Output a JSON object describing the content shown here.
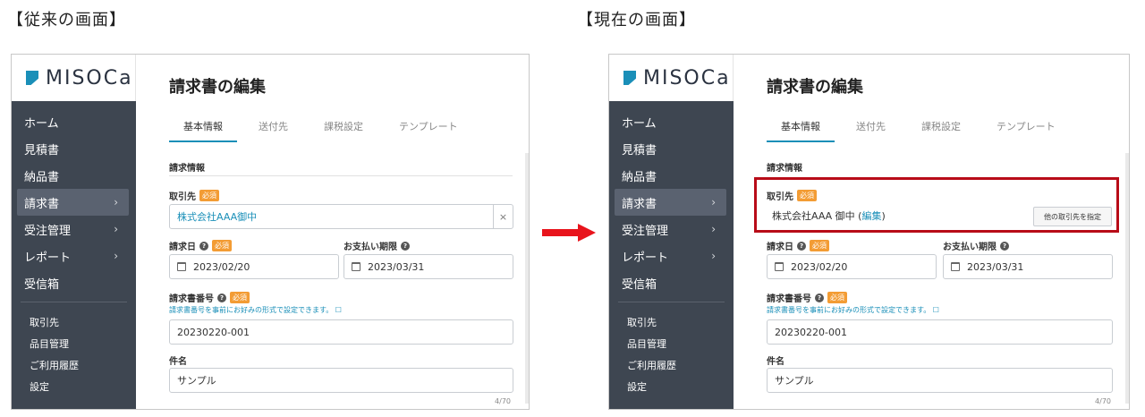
{
  "captions": {
    "left": "【従来の画面】",
    "right": "【現在の画面】"
  },
  "colors": {
    "sidebar": "#3e4651",
    "accent": "#1a8fb8",
    "required": "#f39c34",
    "highlight": "#b80c18",
    "arrow": "#e8141c"
  },
  "logo": {
    "text": "MISOCa"
  },
  "nav": {
    "home": "ホーム",
    "estimate": "見積書",
    "delivery": "納品書",
    "invoice": "請求書",
    "orders": "受注管理",
    "report": "レポート",
    "inbox": "受信箱"
  },
  "subnav": {
    "clients": "取引先",
    "items": "品目管理",
    "history": "ご利用履歴",
    "settings": "設定"
  },
  "page": {
    "title": "請求書の編集"
  },
  "tabs": {
    "basic": "基本情報",
    "destination": "送付先",
    "tax": "課税設定",
    "template": "テンプレート"
  },
  "form": {
    "section": "請求情報",
    "client_label": "取引先",
    "required": "必須",
    "client_value_old": "株式会社AAA御中",
    "clear": "×",
    "client_value_new": "株式会社AAA 御中 (",
    "edit_link": "編集",
    "client_close": ")",
    "other_client_button": "他の取引先を指定",
    "invoice_date_label": "請求日",
    "due_date_label": "お支払い期限",
    "invoice_date": "2023/02/20",
    "due_date": "2023/03/31",
    "number_label": "請求書番号",
    "number_hint": "請求書番号を事前にお好みの形式で設定できます。 ☐",
    "number_value": "20230220-001",
    "subject_label": "件名",
    "subject_value": "サンプル",
    "counter": "4/70"
  }
}
